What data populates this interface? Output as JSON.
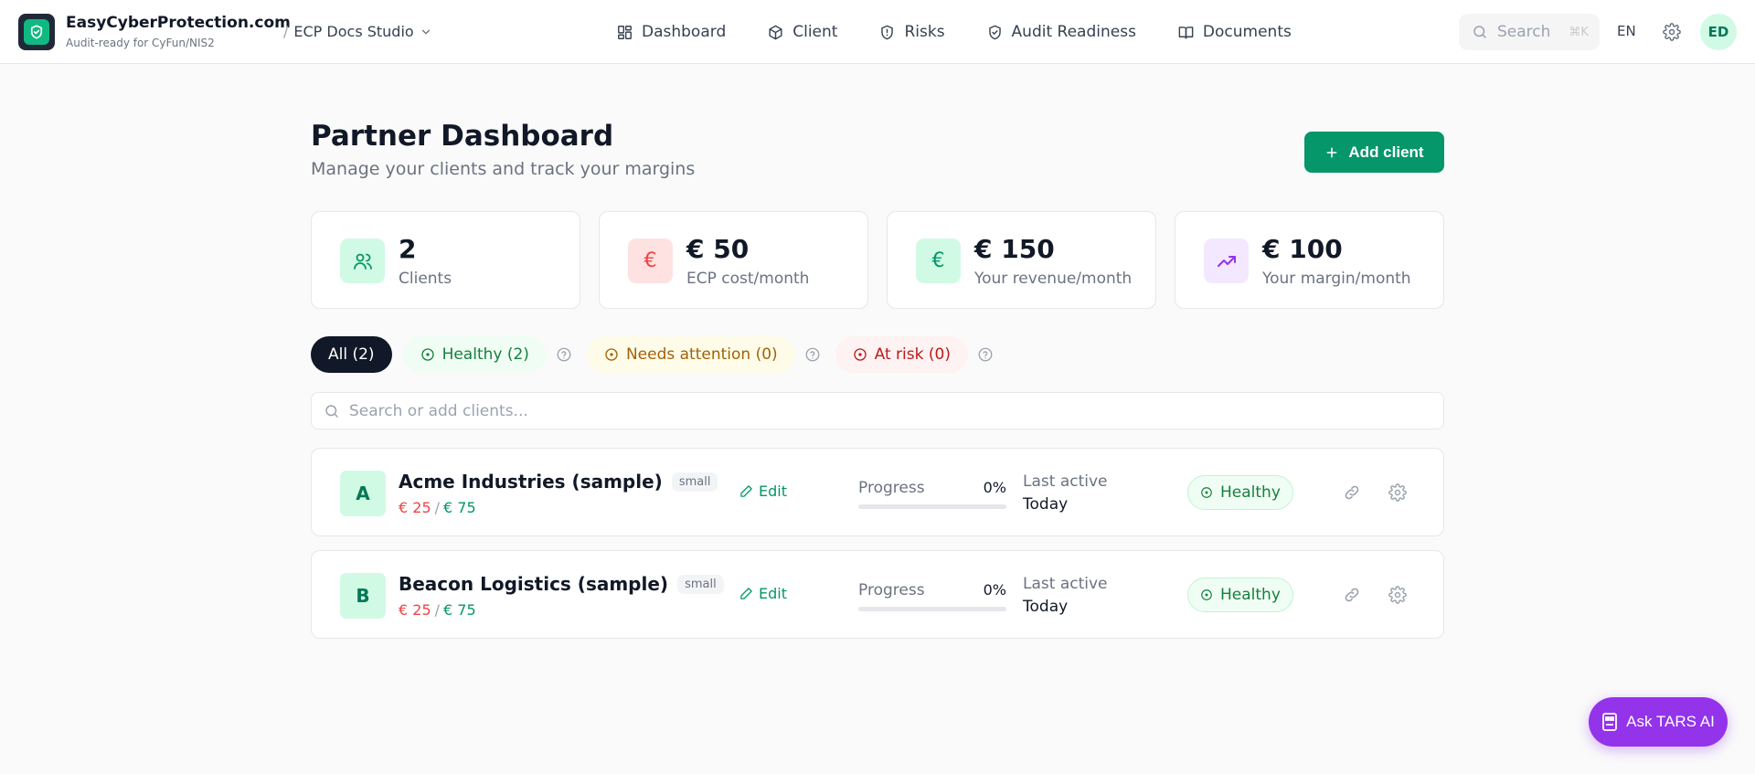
{
  "header": {
    "brand_name": "EasyCyberProtection.com",
    "brand_tagline": "Audit-ready for CyFun/NIS2",
    "workspace": "ECP Docs Studio",
    "nav": [
      "Dashboard",
      "Client",
      "Risks",
      "Audit Readiness",
      "Documents"
    ],
    "search_placeholder": "Search",
    "search_shortcut": "⌘K",
    "language": "EN",
    "user_initials": "ED"
  },
  "page": {
    "title": "Partner Dashboard",
    "subtitle": "Manage your clients and track your margins",
    "add_client_label": "Add client"
  },
  "stats": [
    {
      "value": "2",
      "label": "Clients",
      "icon": "users-icon",
      "color": "#059669",
      "bg": "#d1fae5"
    },
    {
      "value": "€ 50",
      "label": "ECP cost/month",
      "icon": "euro-icon",
      "color": "#ef4444",
      "bg": "#fee2e2"
    },
    {
      "value": "€ 150",
      "label": "Your revenue/month",
      "icon": "euro-icon",
      "color": "#059669",
      "bg": "#d1fae5"
    },
    {
      "value": "€ 100",
      "label": "Your margin/month",
      "icon": "trending-up-icon",
      "color": "#9333ea",
      "bg": "#f3e8ff"
    }
  ],
  "filters": {
    "all": "All (2)",
    "healthy": "Healthy (2)",
    "attention": "Needs attention (0)",
    "risk": "At risk (0)"
  },
  "client_search_placeholder": "Search or add clients...",
  "clients": [
    {
      "initial": "A",
      "name": "Acme Industries (sample)",
      "size": "small",
      "cost": "€ 25",
      "revenue": "€ 75",
      "edit_label": "Edit",
      "progress_label": "Progress",
      "progress_text": "0%",
      "progress_value": 0,
      "last_active_label": "Last active",
      "last_active": "Today",
      "status": "Healthy"
    },
    {
      "initial": "B",
      "name": "Beacon Logistics (sample)",
      "size": "small",
      "cost": "€ 25",
      "revenue": "€ 75",
      "edit_label": "Edit",
      "progress_label": "Progress",
      "progress_text": "0%",
      "progress_value": 0,
      "last_active_label": "Last active",
      "last_active": "Today",
      "status": "Healthy"
    }
  ],
  "assistant": {
    "label": "Ask TARS AI"
  },
  "colors": {
    "accent": "#059669",
    "dark": "#111827",
    "purple": "#9333ea"
  }
}
